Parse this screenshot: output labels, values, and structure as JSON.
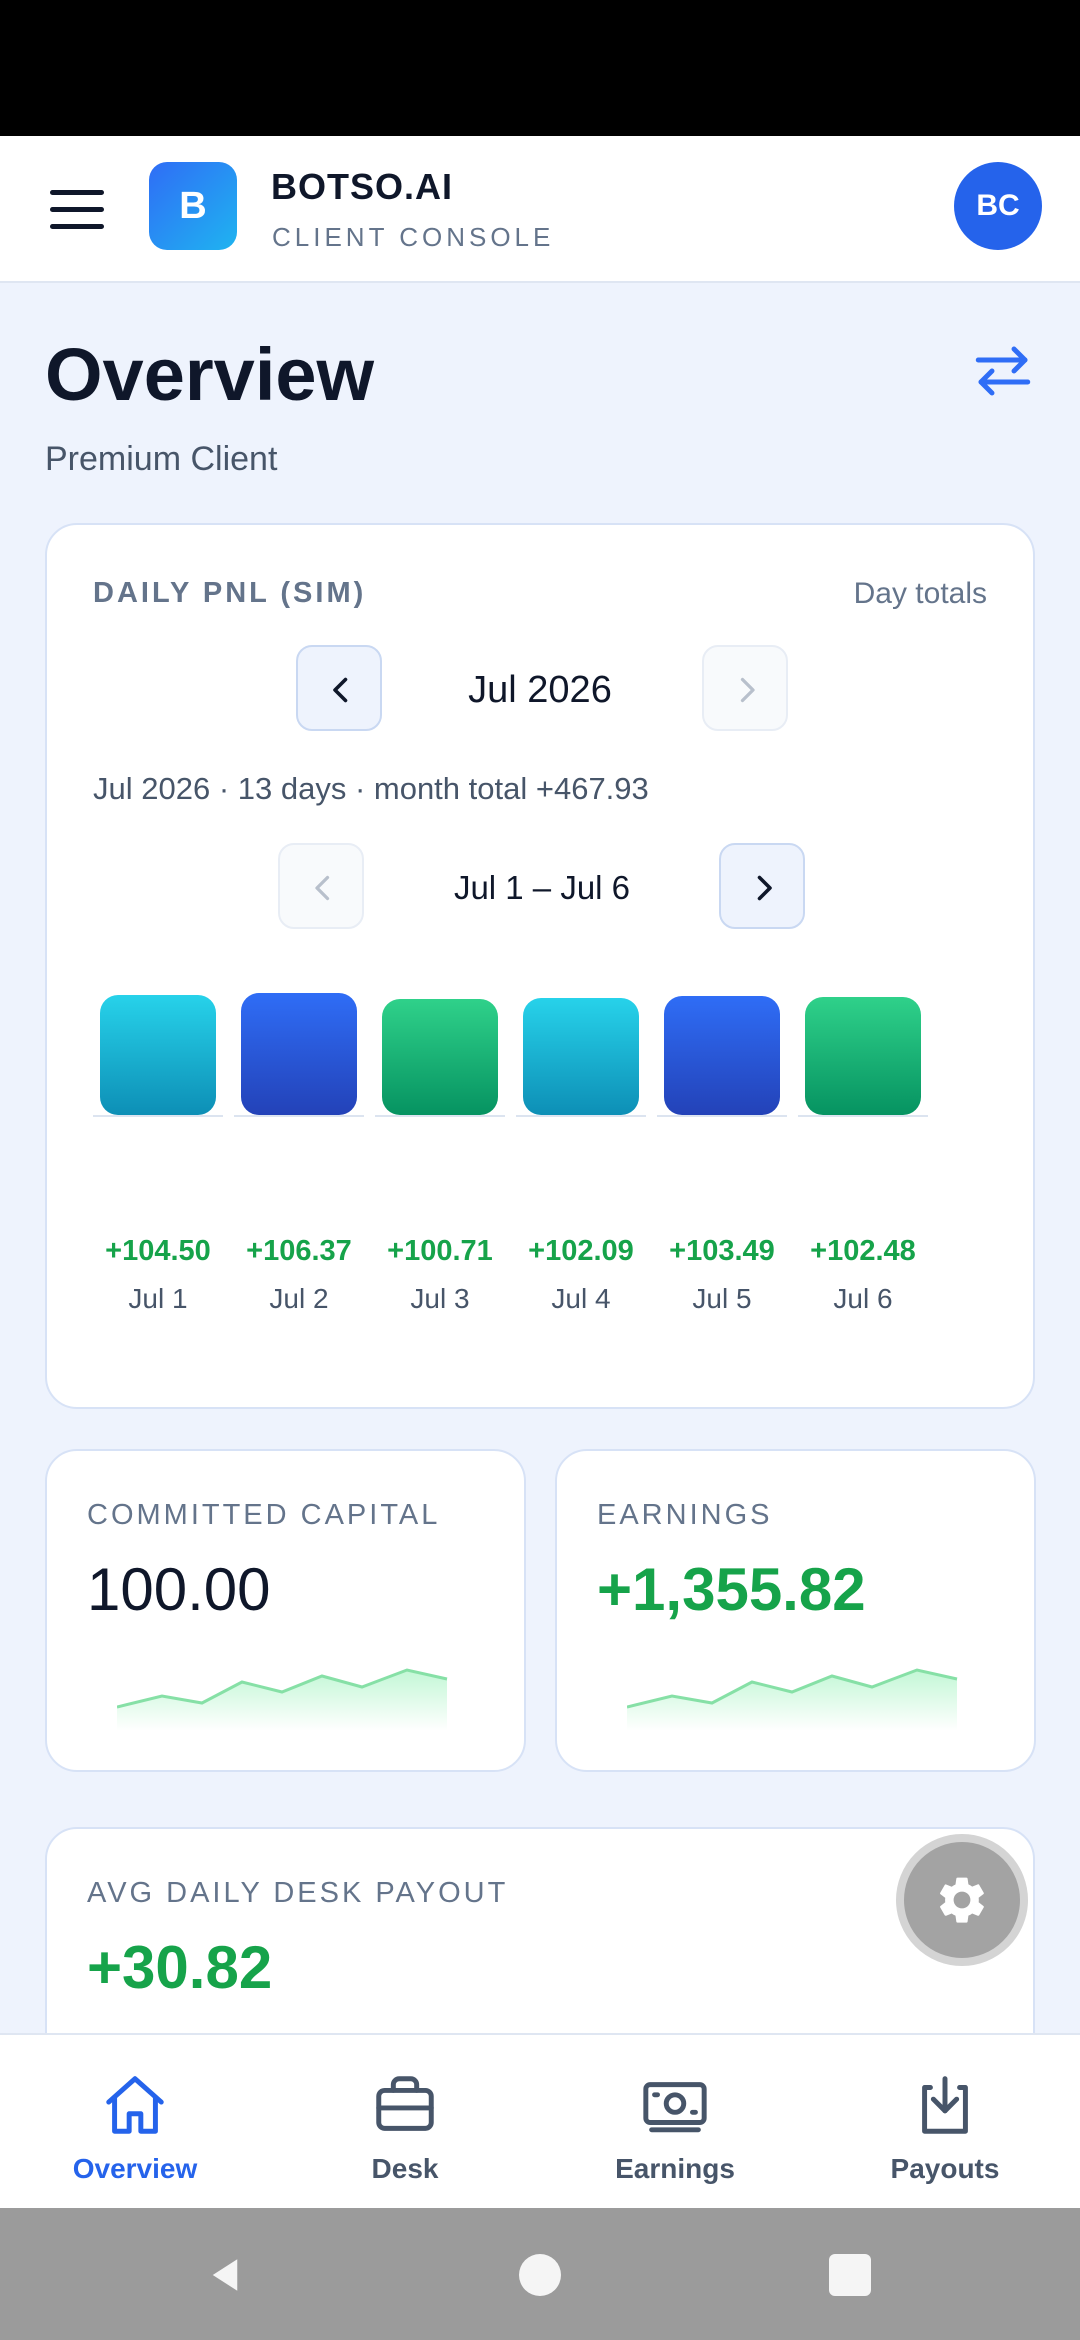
{
  "header": {
    "logo_letter": "B",
    "brand": "BOTSO.AI",
    "subtitle": "CLIENT CONSOLE",
    "avatar_initials": "BC"
  },
  "page": {
    "title": "Overview",
    "subtitle": "Premium Client"
  },
  "pnl": {
    "label": "DAILY PNL (SIM)",
    "mode": "Day totals",
    "month": "Jul 2026",
    "summary": "Jul 2026 · 13 days · month total +467.93",
    "week_range": "Jul 1 – Jul 6",
    "colors": {
      "cyan": "#22c7e6",
      "blue": "#2d63e8",
      "green": "#22c07f",
      "positive": "#16a34a"
    }
  },
  "chart_data": {
    "type": "bar",
    "title": "DAILY PNL (SIM)",
    "categories": [
      "Jul 1",
      "Jul 2",
      "Jul 3",
      "Jul 4",
      "Jul 5",
      "Jul 6"
    ],
    "values": [
      104.5,
      106.37,
      100.71,
      102.09,
      103.49,
      102.48
    ],
    "value_labels": [
      "+104.50",
      "+106.37",
      "+100.71",
      "+102.09",
      "+103.49",
      "+102.48"
    ],
    "bar_colors": [
      "cyan",
      "blue",
      "green",
      "cyan",
      "blue",
      "green"
    ]
  },
  "stats": {
    "capital": {
      "label": "COMMITTED CAPITAL",
      "value": "100.00"
    },
    "earnings": {
      "label": "EARNINGS",
      "value": "+1,355.82"
    },
    "avg_payout": {
      "label": "AVG DAILY DESK PAYOUT",
      "value": "+30.82"
    }
  },
  "bottom_nav": {
    "items": [
      {
        "label": "Overview",
        "icon": "home-icon",
        "active": true
      },
      {
        "label": "Desk",
        "icon": "briefcase-icon",
        "active": false
      },
      {
        "label": "Earnings",
        "icon": "banknote-icon",
        "active": false
      },
      {
        "label": "Payouts",
        "icon": "download-icon",
        "active": false
      }
    ]
  }
}
